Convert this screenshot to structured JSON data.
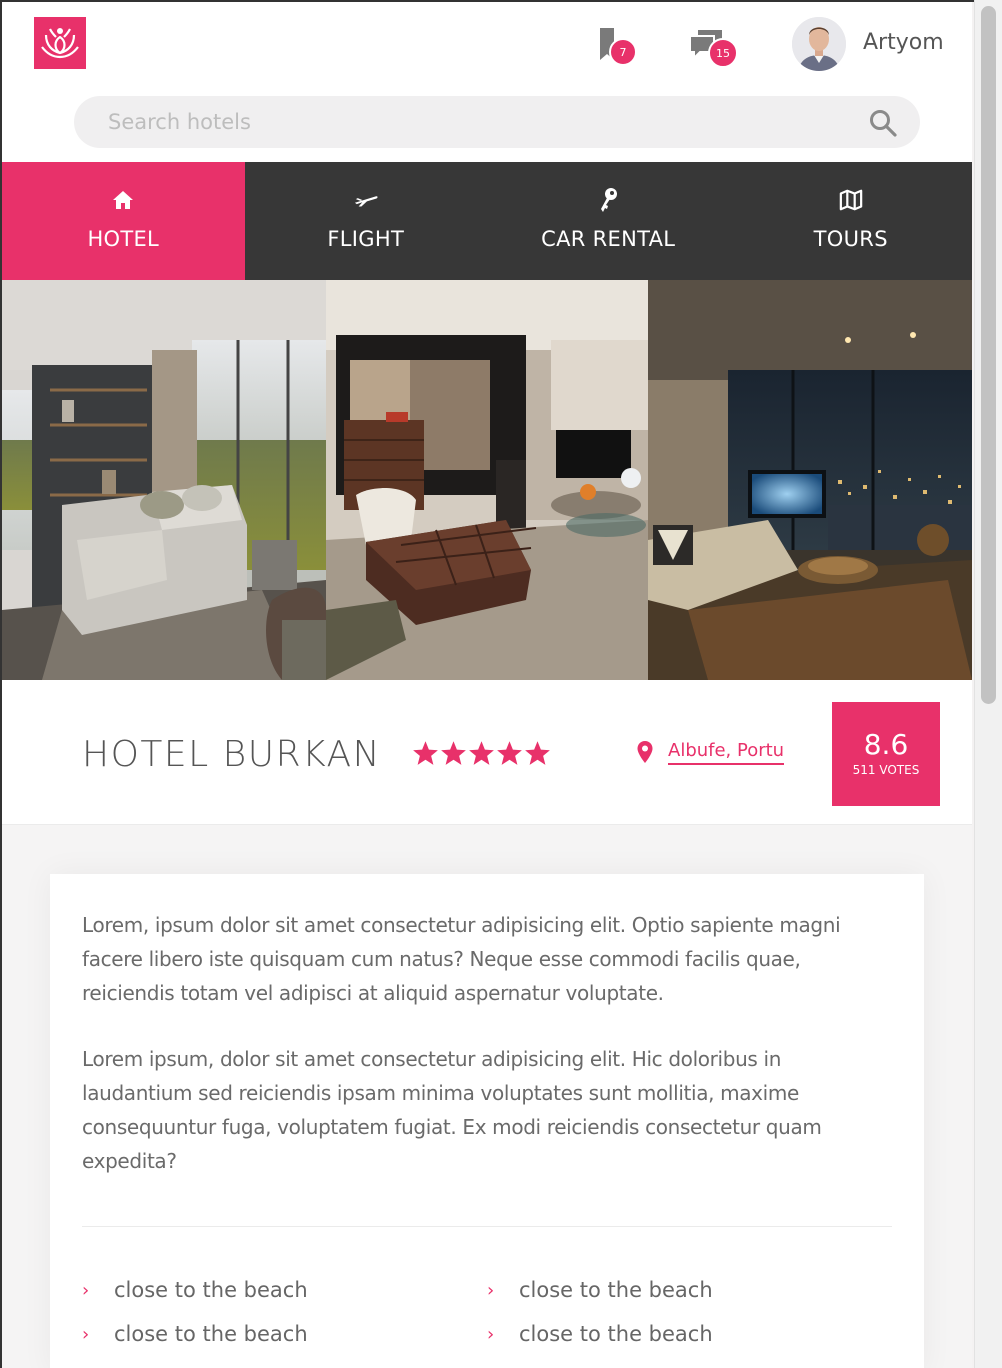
{
  "header": {
    "logo_alt": "logo",
    "bookmark_count": "7",
    "messages_count": "15",
    "username": "Artyom"
  },
  "search": {
    "placeholder": "Search hotels",
    "value": ""
  },
  "nav": {
    "tabs": [
      {
        "label": "HOTEL",
        "icon": "home-icon",
        "active": true
      },
      {
        "label": "FLIGHT",
        "icon": "plane-icon",
        "active": false
      },
      {
        "label": "CAR RENTAL",
        "icon": "key-icon",
        "active": false
      },
      {
        "label": "TOURS",
        "icon": "map-icon",
        "active": false
      }
    ]
  },
  "gallery": {
    "photos": [
      "hotel-room-photo-1",
      "hotel-room-photo-2",
      "hotel-room-photo-3"
    ]
  },
  "hotel": {
    "name": "HOTEL BURKAN",
    "stars": 5,
    "location": "Albufe, Portu",
    "rating": "8.6",
    "votes": "511 VOTES"
  },
  "description": {
    "paragraph_1": "Lorem, ipsum dolor sit amet consectetur adipisicing elit. Optio sapiente magni facere libero iste quisquam cum natus? Neque esse commodi facilis quae, reiciendis totam vel adipisci at aliquid aspernatur voluptate.",
    "paragraph_2": "Lorem ipsum, dolor sit amet consectetur adipisicing elit. Hic doloribus in laudantium sed reiciendis ipsam minima voluptates sunt mollitia, maxime consequuntur fuga, voluptatem fugiat. Ex modi reiciendis consectetur quam expedita?"
  },
  "features": [
    "close to the beach",
    "close to the beach",
    "close to the beach",
    "close to the beach"
  ],
  "colors": {
    "accent": "#e8316a",
    "nav_bg": "#373737",
    "text": "#6a6a6a"
  }
}
